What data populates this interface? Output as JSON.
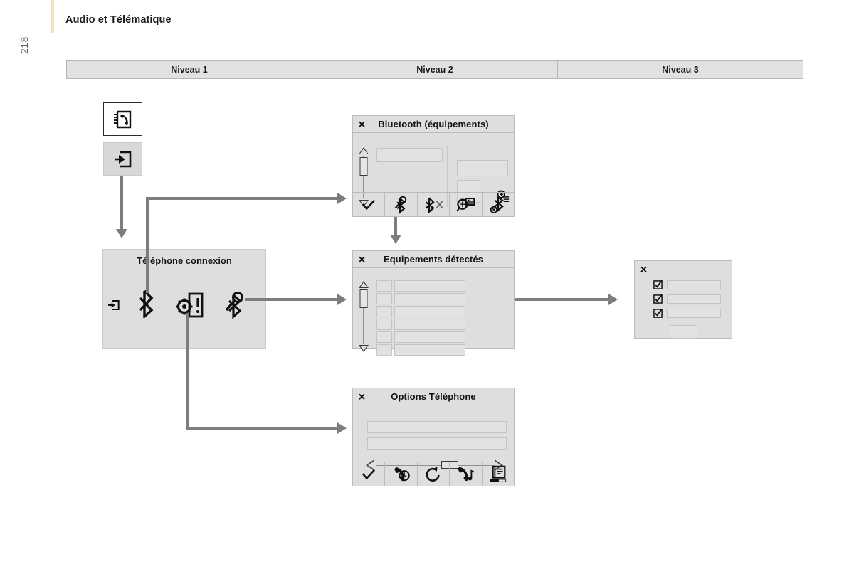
{
  "page": {
    "title": "Audio et Télématique",
    "number": "218"
  },
  "levels": {
    "columns": [
      {
        "label": "Niveau 1"
      },
      {
        "label": "Niveau 2"
      },
      {
        "label": "Niveau 3"
      }
    ]
  },
  "level1": {
    "tiles": [
      {
        "name": "phonebook-tile",
        "icon": "phonebook-icon",
        "background": "#ffffff"
      },
      {
        "name": "enter-tile",
        "icon": "enter-arrow-icon",
        "background": "#d6d8da"
      }
    ],
    "phone_connection": {
      "title": "Téléphone connexion",
      "icons": [
        {
          "name": "enter-arrow-icon",
          "label": "enter-arrow-icon"
        },
        {
          "name": "bluetooth-icon",
          "label": "bluetooth-icon"
        },
        {
          "name": "phone-settings-icon",
          "label": "phone-settings-icon"
        },
        {
          "name": "bluetooth-search-icon",
          "label": "bluetooth-search-icon"
        }
      ]
    }
  },
  "dialogs": {
    "bluetooth": {
      "title": "Bluetooth (équipements)",
      "close_glyph": "✕",
      "toolbar": [
        {
          "name": "confirm-icon",
          "glyph": "check"
        },
        {
          "name": "bluetooth-search-icon",
          "glyph": "bt-search"
        },
        {
          "name": "bluetooth-off-icon",
          "glyph": "bt-off"
        },
        {
          "name": "search-info-icon",
          "glyph": "search-info"
        },
        {
          "name": "bluetooth-disconnect-icon",
          "glyph": "bt-disconnect"
        }
      ],
      "fields": 4,
      "magnifier_icon": "magnifier-list-icon"
    },
    "detected_devices": {
      "title": "Equipements détectés",
      "close_glyph": "✕",
      "rows": 6
    },
    "device_select": {
      "close_glyph": "✕",
      "checkbox_rows": 3,
      "checkbox_glyph": "✔",
      "has_button": true
    },
    "phone_options": {
      "title": "Options Téléphone",
      "close_glyph": "✕",
      "fields": 2,
      "slider": {
        "left_arrow": "◁",
        "right_arrow": "▷",
        "position_percent": 58
      },
      "toolbar": [
        {
          "name": "confirm-icon",
          "glyph": "check"
        },
        {
          "name": "call-timer-icon",
          "glyph": "phone-clock"
        },
        {
          "name": "redial-icon",
          "glyph": "rotate"
        },
        {
          "name": "ringtone-icon",
          "glyph": "phone-music"
        },
        {
          "name": "phonebook-sync-icon",
          "glyph": "phonebook-sync"
        }
      ]
    }
  },
  "colors": {
    "accent": "#f0e3c2",
    "header_fill": "#dfe1e2",
    "dialog_fill": "#dcdedf",
    "connector": "#7b7d7f",
    "border": "#b9bbbd"
  }
}
